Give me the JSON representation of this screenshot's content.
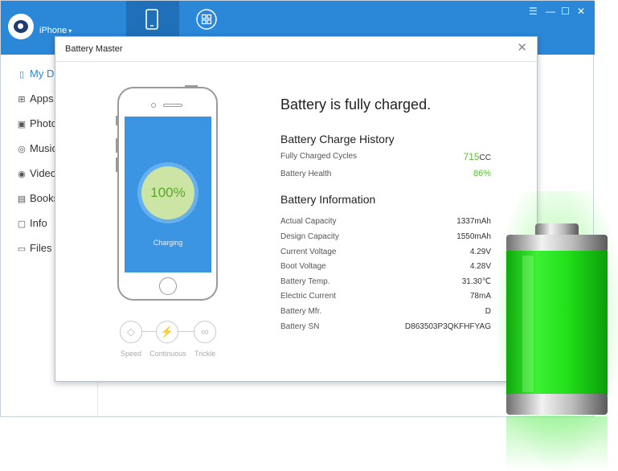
{
  "app": {
    "device_label": "iPhone",
    "device_caret": "▾",
    "tabs": [
      "device-tab",
      "apps-tab"
    ],
    "window_controls": [
      "☰",
      "—",
      "☐",
      "✕"
    ],
    "sidebar": [
      {
        "label": "My Device",
        "icon": "phone-icon"
      },
      {
        "label": "Apps",
        "icon": "apps-icon"
      },
      {
        "label": "Photos",
        "icon": "photo-icon"
      },
      {
        "label": "Music",
        "icon": "music-icon"
      },
      {
        "label": "Videos",
        "icon": "video-icon"
      },
      {
        "label": "Books",
        "icon": "book-icon"
      },
      {
        "label": "Info",
        "icon": "info-icon"
      },
      {
        "label": "Files",
        "icon": "folder-icon"
      }
    ]
  },
  "dialog": {
    "title": "Battery Master",
    "close": "✕",
    "phone": {
      "percent": "100%",
      "status": "Charging"
    },
    "modes": [
      {
        "label": "Speed",
        "glyph": "◇"
      },
      {
        "label": "Continuous",
        "glyph": "⚡"
      },
      {
        "label": "Trickle",
        "glyph": "∞"
      }
    ],
    "headline": "Battery is fully charged.",
    "history": {
      "title": "Battery Charge History",
      "cycles_label": "Fully Charged Cycles",
      "cycles_value": "715",
      "cycles_unit": "CC",
      "health_label": "Battery Health",
      "health_value": "86%"
    },
    "info": {
      "title": "Battery Information",
      "rows": [
        {
          "label": "Actual Capacity",
          "value": "1337mAh"
        },
        {
          "label": "Design Capacity",
          "value": "1550mAh"
        },
        {
          "label": "Current Voltage",
          "value": "4.29V"
        },
        {
          "label": "Boot Voltage",
          "value": "4.28V"
        },
        {
          "label": "Battery Temp.",
          "value": "31.30℃"
        },
        {
          "label": "Electric Current",
          "value": "78mA"
        },
        {
          "label": "Battery Mfr.",
          "value": "D"
        },
        {
          "label": "Battery SN",
          "value": "D863503P3QKFHFYAG"
        }
      ]
    }
  },
  "colors": {
    "accent": "#2b88d9",
    "good": "#5ac131",
    "battery_green": "#27e31f"
  }
}
